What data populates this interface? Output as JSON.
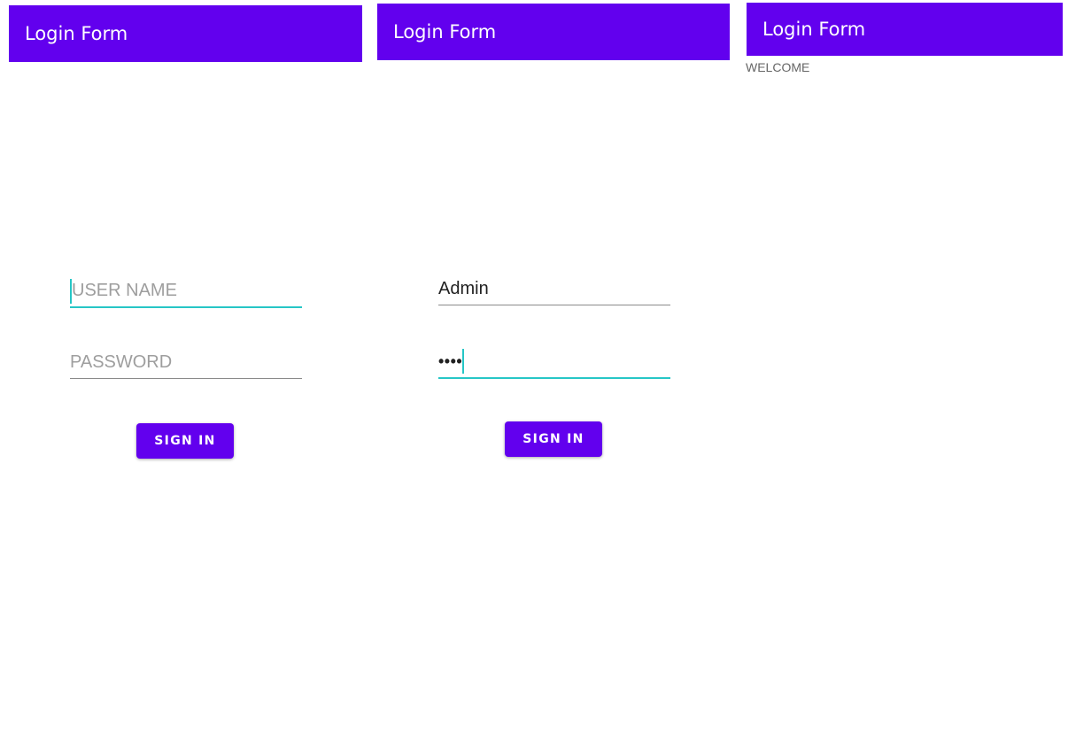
{
  "screens": [
    {
      "appbar_title": "Login Form",
      "username": {
        "placeholder": "USER NAME",
        "value": ""
      },
      "password": {
        "placeholder": "PASSWORD",
        "value": ""
      },
      "signin_label": "SIGN IN"
    },
    {
      "appbar_title": "Login Form",
      "username": {
        "placeholder": "USER NAME",
        "value": "Admin"
      },
      "password": {
        "placeholder": "PASSWORD",
        "value": "••••"
      },
      "signin_label": "SIGN IN"
    },
    {
      "appbar_title": "Login Form",
      "welcome_text": "WELCOME"
    }
  ],
  "colors": {
    "primary": "#6200EE",
    "accent": "#26C6C6",
    "placeholder": "#9E9E9E"
  }
}
